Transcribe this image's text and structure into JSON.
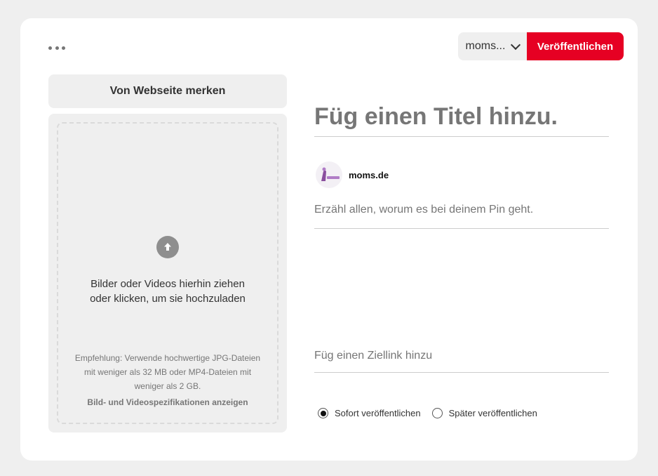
{
  "header": {
    "more_icon": "ellipsis-icon",
    "board_select_value": "moms...",
    "publish_label": "Veröffentlichen",
    "accent_color": "#e60023"
  },
  "left": {
    "save_from_website_label": "Von Webseite merken",
    "upload_icon": "arrow-up-circle-icon",
    "upload_text": "Bilder oder Videos hierhin ziehen oder klicken, um sie hochzuladen",
    "recommendation_text": "Empfehlung: Verwende hochwertige JPG-Dateien mit weniger als 32 MB oder MP4-Dateien mit weniger als 2 GB.",
    "specs_link": "Bild- und Videospezifikationen anzeigen"
  },
  "form": {
    "title_placeholder": "Füg einen Titel hinzu.",
    "account_name": "moms.de",
    "description_placeholder": "Erzähl allen, worum es bei deinem Pin geht.",
    "link_placeholder": "Füg einen Ziellink hinzu",
    "publish_options": [
      {
        "label": "Sofort veröffentlichen",
        "checked": true
      },
      {
        "label": "Später veröffentlichen",
        "checked": false
      }
    ]
  }
}
